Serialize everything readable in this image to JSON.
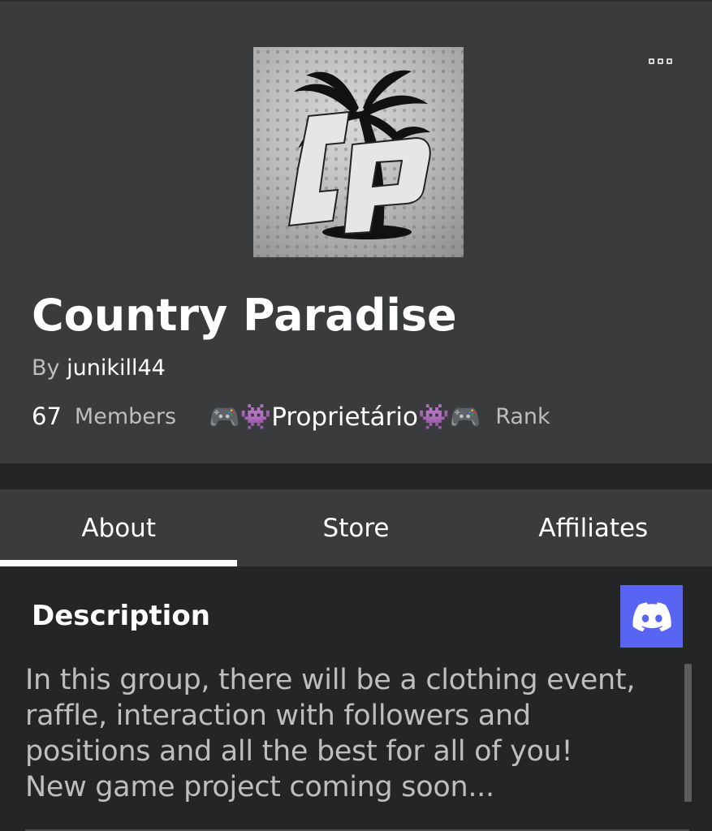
{
  "group": {
    "name": "Country Paradise",
    "by_label": "By",
    "owner": "junikill44",
    "member_count": "67",
    "members_label": "Members",
    "rank_value": "🎮👾Proprietário👾🎮",
    "rank_label": "Rank",
    "emblem_text": "Cp"
  },
  "tabs": [
    {
      "label": "About",
      "active": true
    },
    {
      "label": "Store",
      "active": false
    },
    {
      "label": "Affiliates",
      "active": false
    }
  ],
  "about": {
    "title": "Description",
    "description": "In this group, there will be a clothing event,\nraffle, interaction with followers and\npositions and all the best for all of you!\nNew game project coming soon..."
  },
  "icons": {
    "more": "more-options-icon",
    "discord": "discord-icon"
  },
  "colors": {
    "header_bg": "#393b3d",
    "page_bg": "#232527",
    "discord": "#5865f2",
    "text_secondary": "#bdbebe"
  }
}
